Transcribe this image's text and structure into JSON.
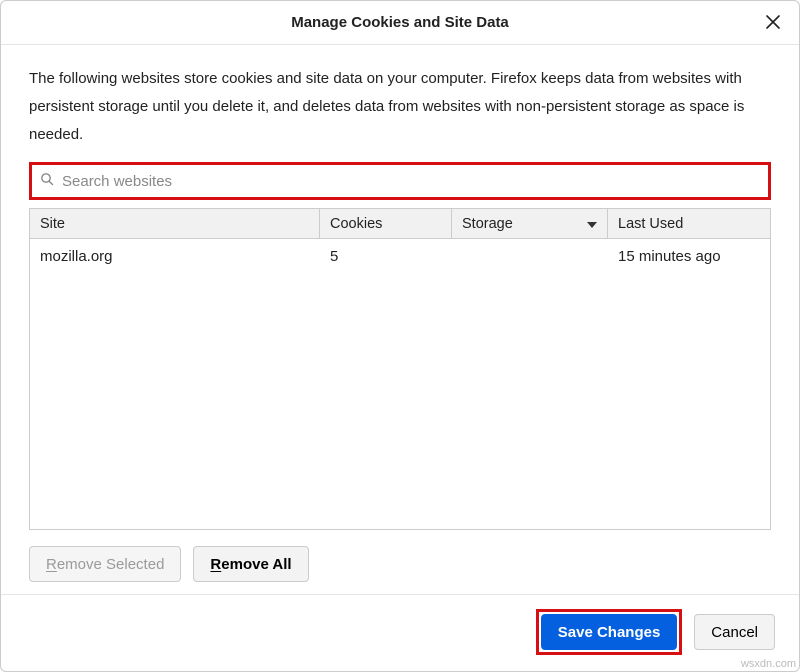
{
  "dialog": {
    "title": "Manage Cookies and Site Data",
    "description": "The following websites store cookies and site data on your computer. Firefox keeps data from websites with persistent storage until you delete it, and deletes data from websites with non-persistent storage as space is needed."
  },
  "search": {
    "placeholder": "Search websites",
    "value": ""
  },
  "table": {
    "headers": {
      "site": "Site",
      "cookies": "Cookies",
      "storage": "Storage",
      "last_used": "Last Used"
    },
    "sorted_column": "storage",
    "rows": [
      {
        "site": "mozilla.org",
        "cookies": "5",
        "storage": "",
        "last_used": "15 minutes ago"
      }
    ]
  },
  "buttons": {
    "remove_selected_prefix": "R",
    "remove_selected_rest": "emove Selected",
    "remove_all_prefix": "R",
    "remove_all_rest": "emove All",
    "save_changes": "Save Changes",
    "cancel": "Cancel"
  },
  "watermark": "wsxdn.com"
}
